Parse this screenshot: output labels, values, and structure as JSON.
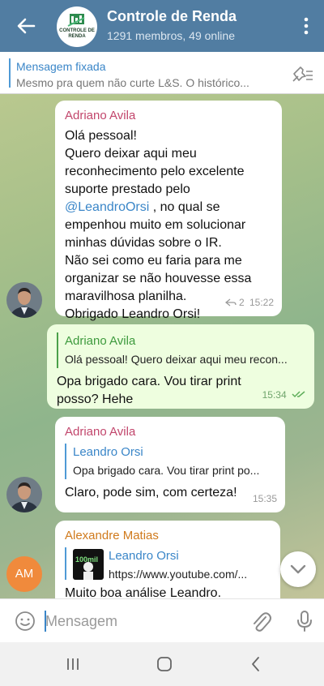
{
  "header": {
    "title": "Controle de Renda",
    "subtitle": "1291 membros, 49 online",
    "logo_text": "CONTROLE DE RENDA"
  },
  "pinned": {
    "title": "Mensagem fixada",
    "text": "Mesmo pra quem não curte L&S. O histórico..."
  },
  "messages": [
    {
      "sender": "Adriano Avila",
      "text_before": "Olá pessoal!\nQuero deixar aqui meu reconhecimento pelo excelente suporte prestado pelo ",
      "mention": "@LeandroOrsi",
      "text_after": " , no qual se empenhou muito em solucionar minhas dúvidas sobre o IR.\nNão sei como eu faria para me organizar se não houvesse essa maravilhosa planilha.\nObrigado Leandro Orsi!",
      "replies": "2",
      "time": "15:22"
    },
    {
      "quote_name": "Adriano Avila",
      "quote_text": "Olá pessoal! Quero deixar aqui meu recon...",
      "text": "Opa brigado cara. Vou tirar print posso? Hehe",
      "time": "15:34"
    },
    {
      "sender": "Adriano Avila",
      "quote_name": "Leandro Orsi",
      "quote_text": "Opa brigado cara. Vou tirar print po...",
      "text": "Claro, pode sim, com certeza!",
      "time": "15:35"
    },
    {
      "sender": "Alexandre Matias",
      "quote_name": "Leandro Orsi",
      "quote_text": "https://www.youtube.com/...",
      "thumb_label": "100mil",
      "text": "Muito boa análise Leandro.",
      "avatar_initials": "AM"
    }
  ],
  "input": {
    "placeholder": "Mensagem"
  },
  "colors": {
    "header": "#517da2",
    "accent": "#3a86c8",
    "outgoing": "#eefedf"
  },
  "icons": [
    "back-arrow-icon",
    "more-vert-icon",
    "unpin-icon",
    "chevron-down-icon",
    "emoji-icon",
    "attach-icon",
    "mic-icon",
    "nav-recents-icon",
    "nav-home-icon",
    "nav-back-icon"
  ]
}
